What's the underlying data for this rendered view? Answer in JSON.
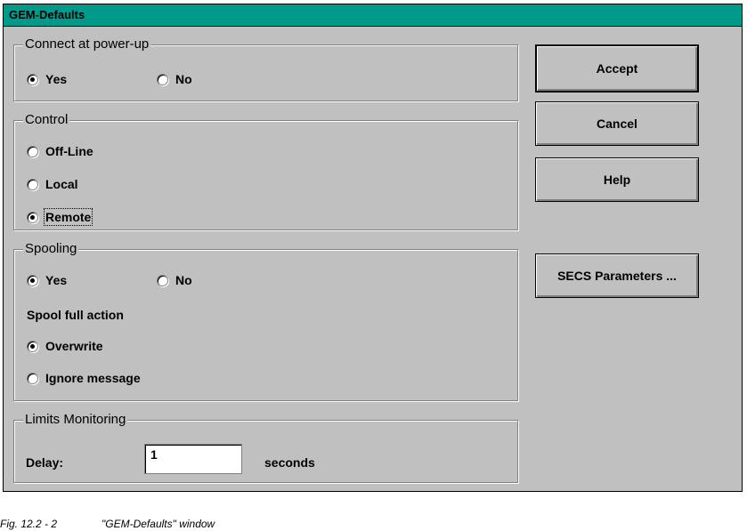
{
  "window": {
    "title": "GEM-Defaults"
  },
  "connect": {
    "legend": "Connect at power-up",
    "yes": "Yes",
    "no": "No",
    "selected": "yes"
  },
  "control": {
    "legend": "Control",
    "offline": "Off-Line",
    "local": "Local",
    "remote": "Remote",
    "selected": "remote"
  },
  "spooling": {
    "legend": "Spooling",
    "yes": "Yes",
    "no": "No",
    "selected": "yes",
    "full_action_label": "Spool full action",
    "overwrite": "Overwrite",
    "ignore": "Ignore message",
    "full_action_selected": "overwrite"
  },
  "limits": {
    "legend": "Limits Monitoring",
    "delay_label": "Delay:",
    "delay_value": "1",
    "unit": "seconds"
  },
  "buttons": {
    "accept": "Accept",
    "cancel": "Cancel",
    "help": "Help",
    "secs": "SECS Parameters ..."
  },
  "caption": {
    "number": "Fig. 12.2 - 2",
    "text": "\"GEM-Defaults\" window"
  },
  "colors": {
    "titlebar": "#009a8a",
    "face": "#c0c0c0"
  }
}
